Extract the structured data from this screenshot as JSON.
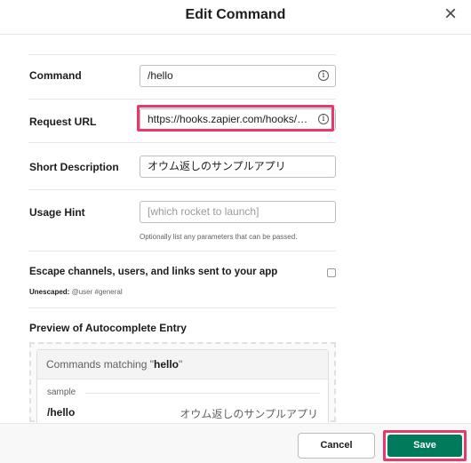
{
  "header": {
    "title": "Edit Command",
    "close_glyph": "×"
  },
  "form": {
    "command": {
      "label": "Command",
      "value": "/hello",
      "info_glyph": "i"
    },
    "request_url": {
      "label": "Request URL",
      "value": "https://hooks.zapier.com/hooks/cat...",
      "info_glyph": "i"
    },
    "short_description": {
      "label": "Short Description",
      "value": "オウム返しのサンプルアプリ"
    },
    "usage_hint": {
      "label": "Usage Hint",
      "placeholder": "[which rocket to launch]",
      "help": "Optionally list any parameters that can be passed."
    },
    "escape": {
      "label": "Escape channels, users, and links sent to your app",
      "unescaped_label": "Unescaped:",
      "unescaped_example": "@user #general",
      "checked": false
    }
  },
  "preview": {
    "title": "Preview of Autocomplete Entry",
    "heading_prefix": "Commands matching \"",
    "heading_term": "hello",
    "heading_suffix": "\"",
    "group": "sample",
    "command": "/hello",
    "description": "オウム返しのサンプルアプリ"
  },
  "footer": {
    "cancel_label": "Cancel",
    "save_label": "Save"
  },
  "colors": {
    "highlight": "#e8396b",
    "save_bg": "#007a5a"
  }
}
